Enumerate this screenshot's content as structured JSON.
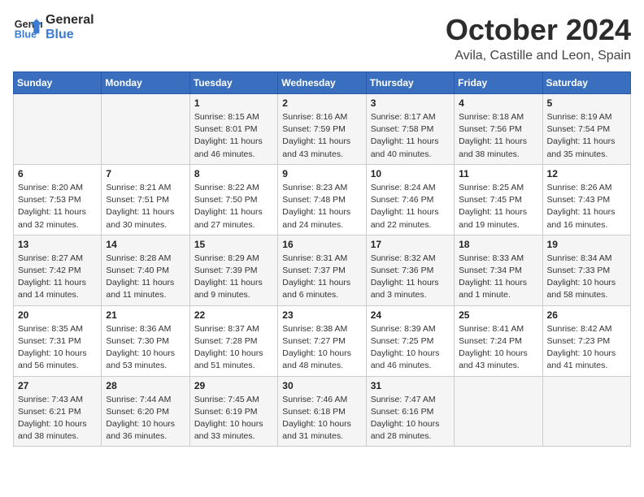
{
  "logo": {
    "line1": "General",
    "line2": "Blue"
  },
  "title": "October 2024",
  "location": "Avila, Castille and Leon, Spain",
  "days_header": [
    "Sunday",
    "Monday",
    "Tuesday",
    "Wednesday",
    "Thursday",
    "Friday",
    "Saturday"
  ],
  "weeks": [
    [
      {
        "day": "",
        "info": ""
      },
      {
        "day": "",
        "info": ""
      },
      {
        "day": "1",
        "info": "Sunrise: 8:15 AM\nSunset: 8:01 PM\nDaylight: 11 hours\nand 46 minutes."
      },
      {
        "day": "2",
        "info": "Sunrise: 8:16 AM\nSunset: 7:59 PM\nDaylight: 11 hours\nand 43 minutes."
      },
      {
        "day": "3",
        "info": "Sunrise: 8:17 AM\nSunset: 7:58 PM\nDaylight: 11 hours\nand 40 minutes."
      },
      {
        "day": "4",
        "info": "Sunrise: 8:18 AM\nSunset: 7:56 PM\nDaylight: 11 hours\nand 38 minutes."
      },
      {
        "day": "5",
        "info": "Sunrise: 8:19 AM\nSunset: 7:54 PM\nDaylight: 11 hours\nand 35 minutes."
      }
    ],
    [
      {
        "day": "6",
        "info": "Sunrise: 8:20 AM\nSunset: 7:53 PM\nDaylight: 11 hours\nand 32 minutes."
      },
      {
        "day": "7",
        "info": "Sunrise: 8:21 AM\nSunset: 7:51 PM\nDaylight: 11 hours\nand 30 minutes."
      },
      {
        "day": "8",
        "info": "Sunrise: 8:22 AM\nSunset: 7:50 PM\nDaylight: 11 hours\nand 27 minutes."
      },
      {
        "day": "9",
        "info": "Sunrise: 8:23 AM\nSunset: 7:48 PM\nDaylight: 11 hours\nand 24 minutes."
      },
      {
        "day": "10",
        "info": "Sunrise: 8:24 AM\nSunset: 7:46 PM\nDaylight: 11 hours\nand 22 minutes."
      },
      {
        "day": "11",
        "info": "Sunrise: 8:25 AM\nSunset: 7:45 PM\nDaylight: 11 hours\nand 19 minutes."
      },
      {
        "day": "12",
        "info": "Sunrise: 8:26 AM\nSunset: 7:43 PM\nDaylight: 11 hours\nand 16 minutes."
      }
    ],
    [
      {
        "day": "13",
        "info": "Sunrise: 8:27 AM\nSunset: 7:42 PM\nDaylight: 11 hours\nand 14 minutes."
      },
      {
        "day": "14",
        "info": "Sunrise: 8:28 AM\nSunset: 7:40 PM\nDaylight: 11 hours\nand 11 minutes."
      },
      {
        "day": "15",
        "info": "Sunrise: 8:29 AM\nSunset: 7:39 PM\nDaylight: 11 hours\nand 9 minutes."
      },
      {
        "day": "16",
        "info": "Sunrise: 8:31 AM\nSunset: 7:37 PM\nDaylight: 11 hours\nand 6 minutes."
      },
      {
        "day": "17",
        "info": "Sunrise: 8:32 AM\nSunset: 7:36 PM\nDaylight: 11 hours\nand 3 minutes."
      },
      {
        "day": "18",
        "info": "Sunrise: 8:33 AM\nSunset: 7:34 PM\nDaylight: 11 hours\nand 1 minute."
      },
      {
        "day": "19",
        "info": "Sunrise: 8:34 AM\nSunset: 7:33 PM\nDaylight: 10 hours\nand 58 minutes."
      }
    ],
    [
      {
        "day": "20",
        "info": "Sunrise: 8:35 AM\nSunset: 7:31 PM\nDaylight: 10 hours\nand 56 minutes."
      },
      {
        "day": "21",
        "info": "Sunrise: 8:36 AM\nSunset: 7:30 PM\nDaylight: 10 hours\nand 53 minutes."
      },
      {
        "day": "22",
        "info": "Sunrise: 8:37 AM\nSunset: 7:28 PM\nDaylight: 10 hours\nand 51 minutes."
      },
      {
        "day": "23",
        "info": "Sunrise: 8:38 AM\nSunset: 7:27 PM\nDaylight: 10 hours\nand 48 minutes."
      },
      {
        "day": "24",
        "info": "Sunrise: 8:39 AM\nSunset: 7:25 PM\nDaylight: 10 hours\nand 46 minutes."
      },
      {
        "day": "25",
        "info": "Sunrise: 8:41 AM\nSunset: 7:24 PM\nDaylight: 10 hours\nand 43 minutes."
      },
      {
        "day": "26",
        "info": "Sunrise: 8:42 AM\nSunset: 7:23 PM\nDaylight: 10 hours\nand 41 minutes."
      }
    ],
    [
      {
        "day": "27",
        "info": "Sunrise: 7:43 AM\nSunset: 6:21 PM\nDaylight: 10 hours\nand 38 minutes."
      },
      {
        "day": "28",
        "info": "Sunrise: 7:44 AM\nSunset: 6:20 PM\nDaylight: 10 hours\nand 36 minutes."
      },
      {
        "day": "29",
        "info": "Sunrise: 7:45 AM\nSunset: 6:19 PM\nDaylight: 10 hours\nand 33 minutes."
      },
      {
        "day": "30",
        "info": "Sunrise: 7:46 AM\nSunset: 6:18 PM\nDaylight: 10 hours\nand 31 minutes."
      },
      {
        "day": "31",
        "info": "Sunrise: 7:47 AM\nSunset: 6:16 PM\nDaylight: 10 hours\nand 28 minutes."
      },
      {
        "day": "",
        "info": ""
      },
      {
        "day": "",
        "info": ""
      }
    ]
  ]
}
